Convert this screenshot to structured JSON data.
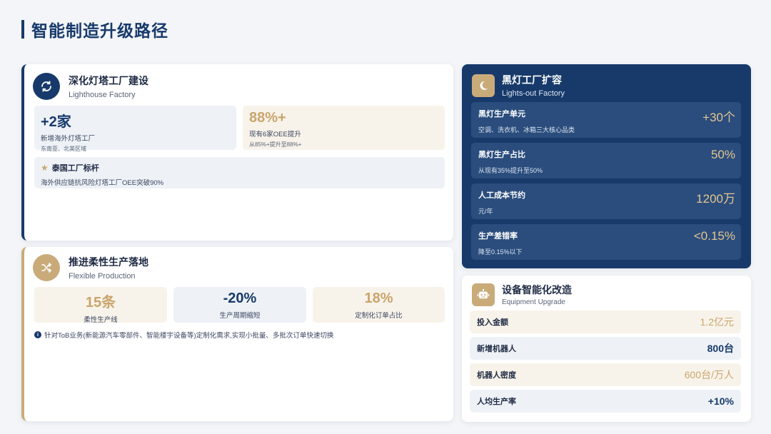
{
  "page": {
    "title": "智能制造升级路径"
  },
  "lighthouse": {
    "title": "深化灯塔工厂建设",
    "subtitle": "Lighthouse Factory",
    "stat1": {
      "value": "+2家",
      "line1": "新增海外灯塔工厂",
      "line2": "东南亚、北美区域"
    },
    "stat2": {
      "value": "88%+",
      "line1": "现有6家OEE提升",
      "line2": "从85%+提升至88%+"
    },
    "benchmark": {
      "title": "泰国工厂标杆",
      "desc": "海外供应链抗风险灯塔工厂OEE突破90%"
    }
  },
  "flexible": {
    "title": "推进柔性生产落地",
    "subtitle": "Flexible Production",
    "stats": [
      {
        "value": "15条",
        "label": "柔性生产线"
      },
      {
        "value": "-20%",
        "label": "生产周期缩短"
      },
      {
        "value": "18%",
        "label": "定制化订单占比"
      }
    ],
    "note": "针对ToB业务(新能源汽车零部件、智能楼宇设备等)定制化需求,实现小批量、多批次订单快速切换"
  },
  "lights_out": {
    "title": "黑灯工厂扩容",
    "subtitle": "Lights-out Factory",
    "rows": [
      {
        "title": "黑灯生产单元",
        "sub": "空调、洗衣机、冰箱三大核心品类",
        "value": "+30个"
      },
      {
        "title": "黑灯生产占比",
        "sub": "从现有35%提升至50%",
        "value": "50%"
      },
      {
        "title": "人工成本节约",
        "sub": "元/年",
        "value": "1200万"
      },
      {
        "title": "生产差错率",
        "sub": "降至0.15%以下",
        "value": "<0.15%"
      }
    ]
  },
  "equipment": {
    "title": "设备智能化改造",
    "subtitle": "Equipment Upgrade",
    "rows": [
      {
        "label": "投入金额",
        "value": "1.2亿元"
      },
      {
        "label": "新增机器人",
        "value": "800台"
      },
      {
        "label": "机器人密度",
        "value": "600台/万人"
      },
      {
        "label": "人均生产率",
        "value": "+10%"
      }
    ]
  },
  "colors": {
    "navy": "#173a6b",
    "gold": "#c9ab7a",
    "gold_text": "#c9a56c"
  },
  "icons": [
    "refresh-icon",
    "shuffle-icon",
    "moon-icon",
    "robot-icon",
    "star-icon",
    "info-icon"
  ]
}
